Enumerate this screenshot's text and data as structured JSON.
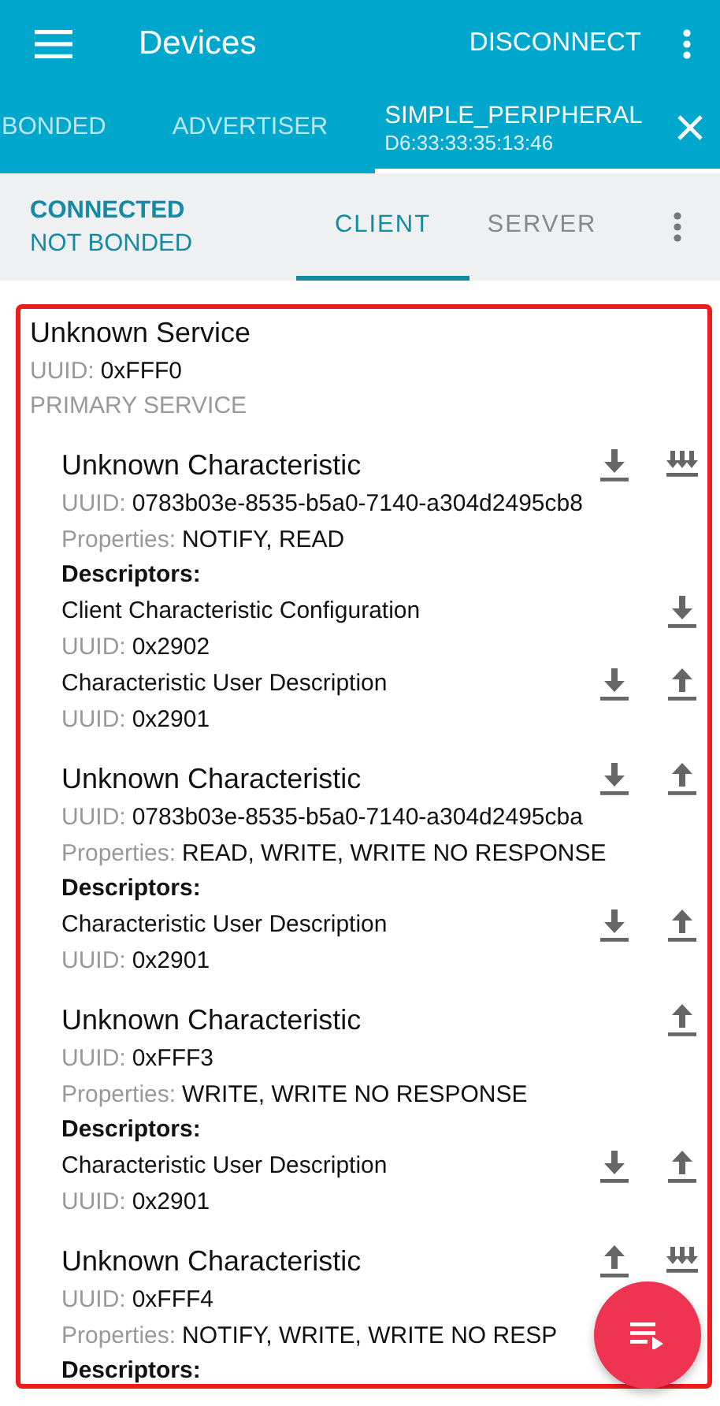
{
  "app_bar": {
    "title": "Devices",
    "action": "DISCONNECT"
  },
  "device_tabs": [
    {
      "label": "BONDED",
      "selected": false
    },
    {
      "label": "ADVERTISER",
      "selected": false
    },
    {
      "label": "SIMPLE_PERIPHERAL",
      "sublabel": "D6:33:33:35:13:46",
      "selected": true,
      "closable": true
    }
  ],
  "status": {
    "connection": "CONNECTED",
    "bond": "NOT BONDED"
  },
  "mode_tabs": [
    {
      "label": "CLIENT",
      "selected": true
    },
    {
      "label": "SERVER",
      "selected": false
    }
  ],
  "services": [
    {
      "name": "Unknown Service",
      "uuid_label": "UUID:",
      "uuid": "0xFFF0",
      "type": "PRIMARY SERVICE",
      "characteristics": [
        {
          "name": "Unknown Characteristic",
          "uuid_label": "UUID:",
          "uuid": "0783b03e-8535-b5a0-7140-a304d2495cb8",
          "properties_label": "Properties:",
          "properties": "NOTIFY, READ",
          "descriptors_label": "Descriptors:",
          "actions": [
            {
              "kind": "read"
            },
            {
              "kind": "notify"
            }
          ],
          "descriptors": [
            {
              "name": "Client Characteristic Configuration",
              "uuid_label": "UUID:",
              "uuid": "0x2902",
              "actions": [
                {
                  "kind": "read"
                }
              ]
            },
            {
              "name": "Characteristic User Description",
              "uuid_label": "UUID:",
              "uuid": "0x2901",
              "actions": [
                {
                  "kind": "read"
                },
                {
                  "kind": "write"
                }
              ]
            }
          ]
        },
        {
          "name": "Unknown Characteristic",
          "uuid_label": "UUID:",
          "uuid": "0783b03e-8535-b5a0-7140-a304d2495cba",
          "properties_label": "Properties:",
          "properties": "READ, WRITE, WRITE NO RESPONSE",
          "descriptors_label": "Descriptors:",
          "actions": [
            {
              "kind": "read"
            },
            {
              "kind": "write"
            }
          ],
          "descriptors": [
            {
              "name": "Characteristic User Description",
              "uuid_label": "UUID:",
              "uuid": "0x2901",
              "actions": [
                {
                  "kind": "read"
                },
                {
                  "kind": "write"
                }
              ]
            }
          ]
        },
        {
          "name": "Unknown Characteristic",
          "uuid_label": "UUID:",
          "uuid": "0xFFF3",
          "properties_label": "Properties:",
          "properties": "WRITE, WRITE NO RESPONSE",
          "descriptors_label": "Descriptors:",
          "actions": [
            {
              "kind": "write"
            }
          ],
          "descriptors": [
            {
              "name": "Characteristic User Description",
              "uuid_label": "UUID:",
              "uuid": "0x2901",
              "actions": [
                {
                  "kind": "read"
                },
                {
                  "kind": "write"
                }
              ]
            }
          ]
        },
        {
          "name": "Unknown Characteristic",
          "uuid_label": "UUID:",
          "uuid": "0xFFF4",
          "properties_label": "Properties:",
          "properties": "NOTIFY, WRITE, WRITE NO RESP",
          "descriptors_label": "Descriptors:",
          "actions": [
            {
              "kind": "write"
            },
            {
              "kind": "notify"
            }
          ]
        }
      ]
    }
  ]
}
